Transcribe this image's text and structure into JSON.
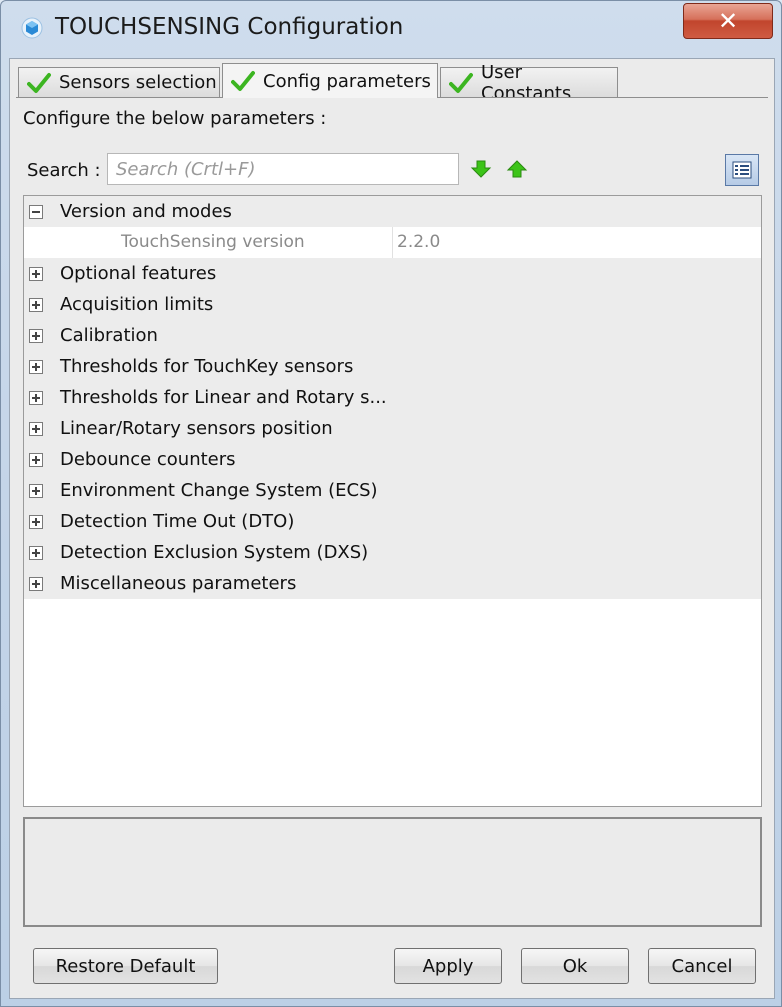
{
  "window": {
    "title": "TOUCHSENSING Configuration",
    "close_symbol": "✕"
  },
  "tabs": [
    {
      "label": "Sensors selection",
      "icon": "check-icon",
      "active": false
    },
    {
      "label": "Config parameters",
      "icon": "check-icon",
      "active": true
    },
    {
      "label": "User Constants",
      "icon": "check-icon",
      "active": false
    }
  ],
  "panel": {
    "instructions": "Configure the below parameters :",
    "search_label": "Search :",
    "search_placeholder": "Search (Crtl+F)",
    "search_value": ""
  },
  "tree": {
    "expanded_group": {
      "label": "Version and modes",
      "property": {
        "name": "TouchSensing version",
        "value": "2.2.0"
      }
    },
    "groups": [
      "Optional features",
      "Acquisition limits",
      "Calibration",
      "Thresholds for TouchKey sensors",
      "Thresholds for Linear and Rotary s...",
      "Linear/Rotary sensors position",
      "Debounce counters",
      "Environment Change System (ECS)",
      "Detection Time Out (DTO)",
      "Detection Exclusion System (DXS)",
      "Miscellaneous parameters"
    ]
  },
  "buttons": {
    "restore_default": "Restore Default",
    "apply": "Apply",
    "ok": "Ok",
    "cancel": "Cancel"
  },
  "colors": {
    "check_green": "#3cb521",
    "arrow_green": "#3cc418",
    "close_red": "#c1452d"
  }
}
